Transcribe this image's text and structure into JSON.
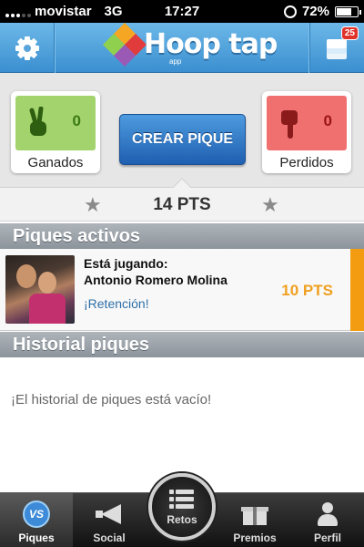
{
  "status_bar": {
    "carrier": "movistar",
    "network": "3G",
    "time": "17:27",
    "battery": "72%",
    "battery_level": 0.72
  },
  "nav": {
    "logo_text": "Hoop tap",
    "logo_sub": "app",
    "notification_count": "25"
  },
  "score": {
    "won_count": "0",
    "won_label": "Ganados",
    "lost_count": "0",
    "lost_label": "Perdidos",
    "create_button": "CREAR PIQUE",
    "points": "14 PTS"
  },
  "active": {
    "header": "Piques activos",
    "rows": [
      {
        "line1": "Está jugando:",
        "player": "Antonio Romero Molina",
        "status": "¡Retención!",
        "points": "10 PTS"
      }
    ]
  },
  "history": {
    "header": "Historial piques",
    "empty_text": "¡El historial de piques está vacío!"
  },
  "tabs": {
    "piques": "Piques",
    "social": "Social",
    "retos": "Retos",
    "premios": "Premios",
    "perfil": "Perfil",
    "vs_icon_text": "VS"
  },
  "colors": {
    "nav_blue": "#3b8fd0",
    "won_green": "#a3d36d",
    "lost_red": "#f07070",
    "points_orange": "#f0a020",
    "accent_stripe": "#f39c12"
  },
  "icons": {
    "settings": "gear-icon",
    "notifications": "layers-icon",
    "won": "victory-hand-icon",
    "lost": "thumbs-down-icon",
    "star": "star-icon"
  }
}
